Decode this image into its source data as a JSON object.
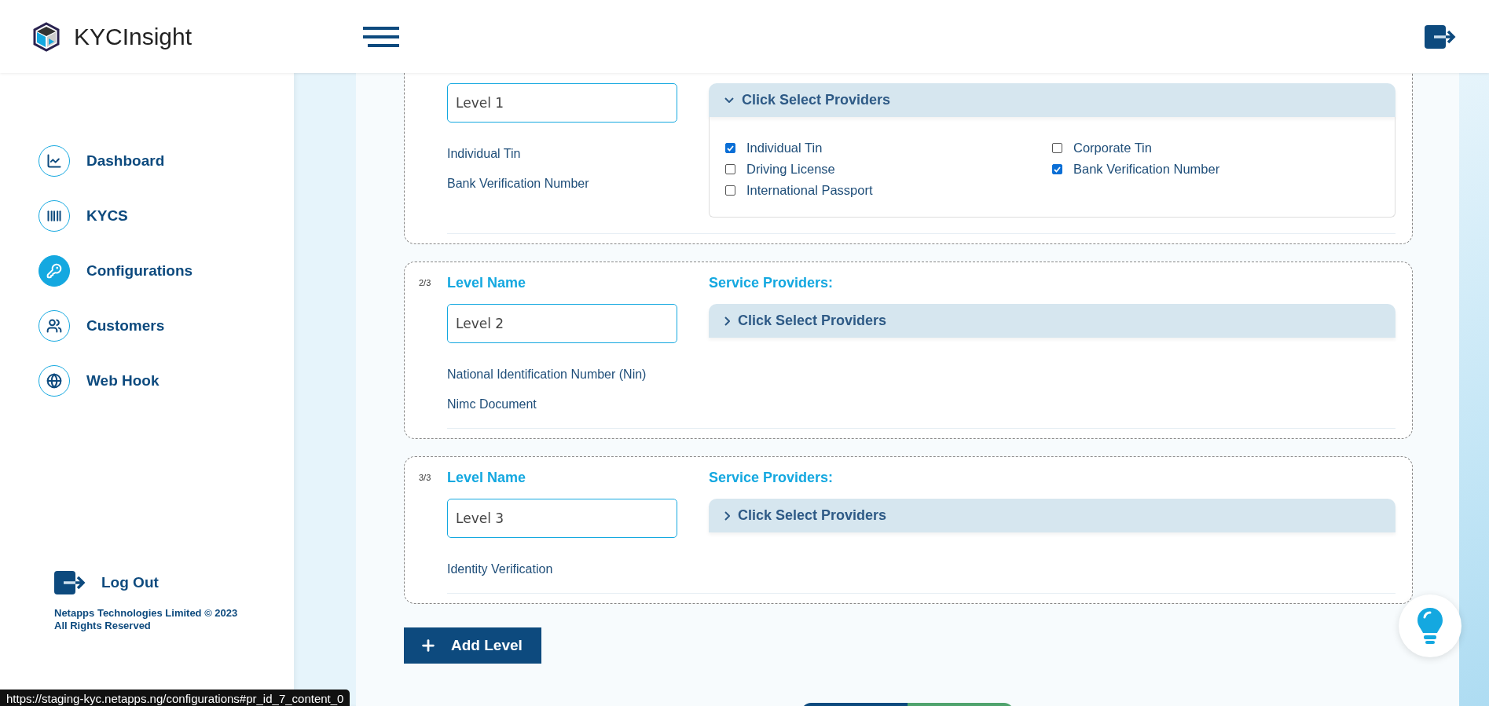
{
  "header": {
    "brand": "KYCInsight"
  },
  "sidebar": {
    "items": [
      {
        "label": "Dashboard",
        "selected": false
      },
      {
        "label": "KYCS",
        "selected": false
      },
      {
        "label": "Configurations",
        "selected": true
      },
      {
        "label": "Customers",
        "selected": false
      },
      {
        "label": "Web Hook",
        "selected": false
      }
    ],
    "logout": "Log Out",
    "footer": "Netapps Technologies Limited © 2023 All Rights Reserved"
  },
  "levels": [
    {
      "name_value": "Level 1",
      "providers": [
        "Individual Tin",
        "Bank Verification Number"
      ],
      "accordion": {
        "title": "Click Select Providers",
        "expanded": true,
        "options": [
          {
            "label": "Individual Tin",
            "checked": true
          },
          {
            "label": "Driving License",
            "checked": false
          },
          {
            "label": "International Passport",
            "checked": false
          },
          {
            "label": "Corporate Tin",
            "checked": false
          },
          {
            "label": "Bank Verification Number",
            "checked": true
          }
        ]
      }
    },
    {
      "counter": "2/3",
      "name_label": "Level Name",
      "providers_label": "Service Providers:",
      "name_value": "Level 2",
      "providers": [
        "National Identification Number (Nin)",
        "Nimc Document"
      ],
      "accordion": {
        "title": "Click Select Providers",
        "expanded": false
      }
    },
    {
      "counter": "3/3",
      "name_label": "Level Name",
      "providers_label": "Service Providers:",
      "name_value": "Level 3",
      "providers": [
        "Identity Verification"
      ],
      "accordion": {
        "title": "Click Select Providers",
        "expanded": false
      }
    }
  ],
  "add_button": "Add Level",
  "status_url": "https://staging-kyc.netapps.ng/configurations#pr_id_7_content_0"
}
